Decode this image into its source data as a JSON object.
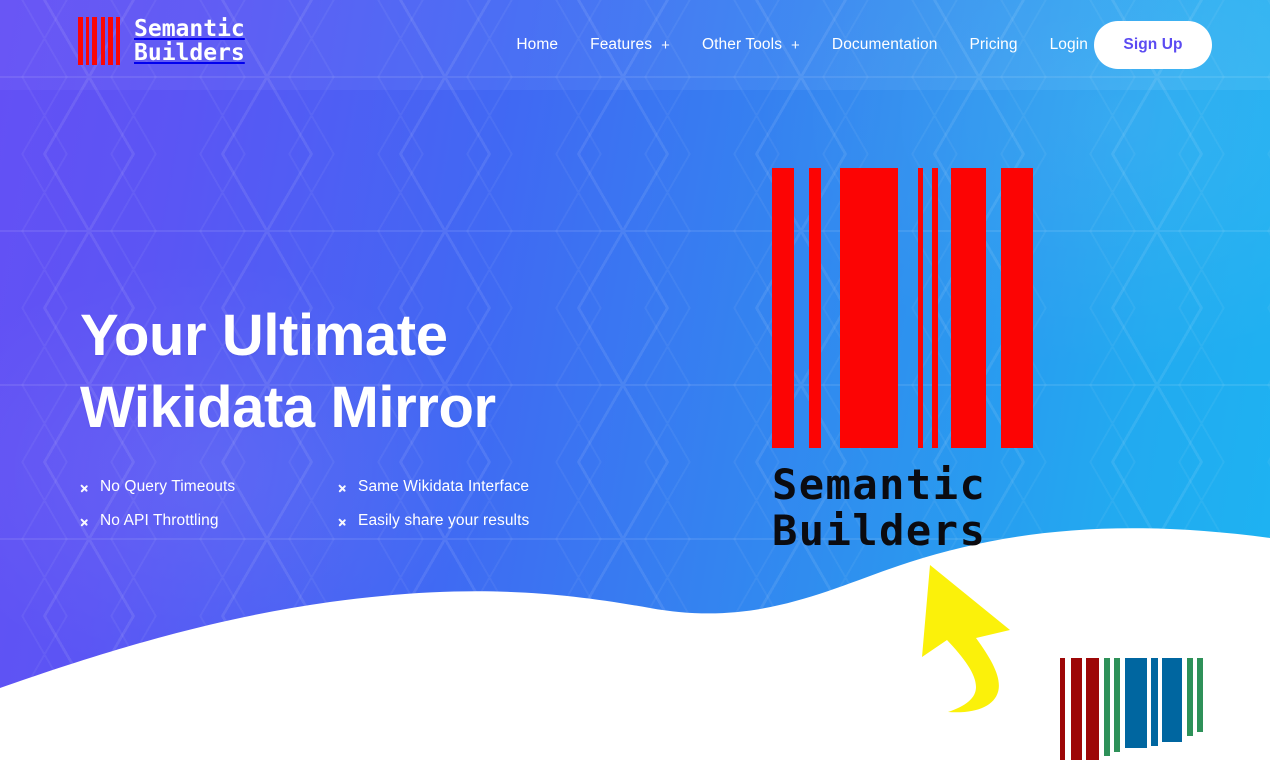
{
  "brand": {
    "name_line1": "Semantic",
    "name_line2": "Builders",
    "logo_icon": "barcode-icon",
    "bar_color": "#fb0606"
  },
  "nav": {
    "items": [
      {
        "label": "Home",
        "has_plus": false,
        "plus": ""
      },
      {
        "label": "Features",
        "has_plus": true,
        "plus": "+"
      },
      {
        "label": "Other Tools",
        "has_plus": true,
        "plus": "+"
      },
      {
        "label": "Documentation",
        "has_plus": false,
        "plus": ""
      },
      {
        "label": "Pricing",
        "has_plus": false,
        "plus": ""
      },
      {
        "label": "Login",
        "has_plus": false,
        "plus": ""
      }
    ],
    "signup_label": "Sign Up",
    "signup_text_color": "#5b4bf2",
    "signup_bg": "#ffffff"
  },
  "hero": {
    "headline_line1": "Your Ultimate",
    "headline_line2": "Wikidata Mirror",
    "features": [
      {
        "label": "No Query Timeouts",
        "icon": "chevron-right-icon"
      },
      {
        "label": "Same Wikidata Interface",
        "icon": "chevron-right-icon"
      },
      {
        "label": "No API Throttling",
        "icon": "chevron-right-icon"
      },
      {
        "label": "Easily share your results",
        "icon": "chevron-right-icon"
      }
    ]
  },
  "artwork": {
    "logo_wordmark_line1": "Semantic",
    "logo_wordmark_line2": "Builders",
    "wordmark_color": "#0b0b10",
    "barcode_color": "#fc0404",
    "arrow_color": "#fbf10a",
    "arrow_icon": "curved-arrow-up-left-icon",
    "wave_color": "#ffffff",
    "mini_barcode_colors": [
      "#9d0707",
      "#2e9159",
      "#0066a0"
    ]
  },
  "theme": {
    "gradient_start": "#6450f5",
    "gradient_end": "#1db4f2",
    "text_on_dark": "#ffffff"
  }
}
